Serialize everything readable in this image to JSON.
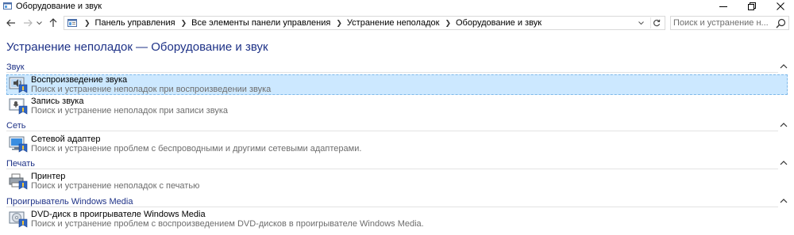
{
  "window": {
    "title": "Оборудование и звук",
    "icon": "control-panel-icon"
  },
  "window_controls": [
    "minimize-icon",
    "maximize-icon",
    "close-icon"
  ],
  "navigation": {
    "back": "back-arrow-icon",
    "forward": "forward-arrow-icon",
    "recent": "chevron-down-icon",
    "up": "up-arrow-icon"
  },
  "address": {
    "crumbs": [
      "Панель управления",
      "Все элементы панели управления",
      "Устранение неполадок",
      "Оборудование и звук"
    ]
  },
  "search": {
    "placeholder": "Поиск и устранение н..."
  },
  "page": {
    "title": "Устранение неполадок — Оборудование и звук"
  },
  "groups": [
    {
      "name": "Звук",
      "items": [
        {
          "title": "Воспроизведение звука",
          "desc": "Поиск и устранение неполадок при воспроизведении звука",
          "selected": true,
          "icon": "speaker-troubleshoot-icon"
        },
        {
          "title": "Запись звука",
          "desc": "Поиск и устранение неполадок при записи звука",
          "selected": false,
          "icon": "microphone-troubleshoot-icon"
        }
      ]
    },
    {
      "name": "Сеть",
      "items": [
        {
          "title": "Сетевой адаптер",
          "desc": "Поиск и устранение проблем с беспроводными и другими сетевыми адаптерами.",
          "selected": false,
          "icon": "network-adapter-icon"
        }
      ]
    },
    {
      "name": "Печать",
      "items": [
        {
          "title": "Принтер",
          "desc": "Поиск и устранение неполадок с печатью",
          "selected": false,
          "icon": "printer-troubleshoot-icon"
        }
      ]
    },
    {
      "name": "Проигрыватель Windows Media",
      "items": [
        {
          "title": "DVD-диск в проигрывателе Windows Media",
          "desc": "Поиск и устранение проблем с воспроизведением DVD-дисков в проигрывателе Windows Media.",
          "selected": false,
          "icon": "dvd-troubleshoot-icon"
        }
      ]
    }
  ],
  "colors": {
    "heading": "#1e3287",
    "selection": "#cce8ff",
    "description": "#6d6d6d"
  }
}
